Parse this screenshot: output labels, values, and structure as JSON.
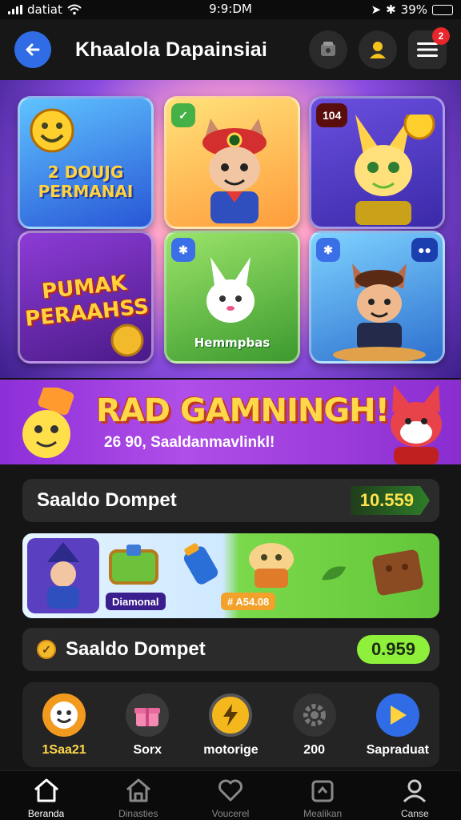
{
  "status": {
    "carrier": "datiat",
    "time": "9:9:DM",
    "battery": "39%",
    "battery_level": 0.39
  },
  "header": {
    "title": "Khaalola Dapainsiai",
    "notification_count": "2"
  },
  "games": [
    {
      "title": "2 DOUJG PERMANAI",
      "badge": ""
    },
    {
      "title": "",
      "badge": "✓"
    },
    {
      "title": "",
      "badge": "104"
    },
    {
      "title": "PUMAK PERAAHSS",
      "badge": ""
    },
    {
      "title": "Hemmpbas",
      "badge": "✱"
    },
    {
      "title": "",
      "badge": "✱"
    }
  ],
  "promo": {
    "title": "RAD GAMNINGH!",
    "subtitle": "26 90, Saaldanmavlinkl!"
  },
  "wallet_top": {
    "label": "Saaldo Dompet",
    "amount": "10.559"
  },
  "strip": {
    "tag1": "Diamonal",
    "tag2": "# A54.08"
  },
  "wallet_bottom": {
    "label": "Saaldo Dompet",
    "amount": "0.959"
  },
  "quick_actions": [
    {
      "label": "1Saa21",
      "icon": "smiley-icon"
    },
    {
      "label": "Sorx",
      "icon": "gift-icon"
    },
    {
      "label": "motorige",
      "icon": "lightning-icon"
    },
    {
      "label": "200",
      "icon": "gear-icon"
    },
    {
      "label": "Sapraduat",
      "icon": "play-icon"
    }
  ],
  "nav": [
    {
      "label": "Beranda",
      "icon": "home-icon"
    },
    {
      "label": "Dinasties",
      "icon": "house-icon"
    },
    {
      "label": "Voucerel",
      "icon": "heart-icon"
    },
    {
      "label": "Mealikan",
      "icon": "bag-icon"
    },
    {
      "label": "Canse",
      "icon": "profile-icon"
    }
  ],
  "colors": {
    "accent": "#2f6ce5",
    "amount": "#ffe34a",
    "green": "#8ef03a",
    "promo": "#a63de0"
  }
}
